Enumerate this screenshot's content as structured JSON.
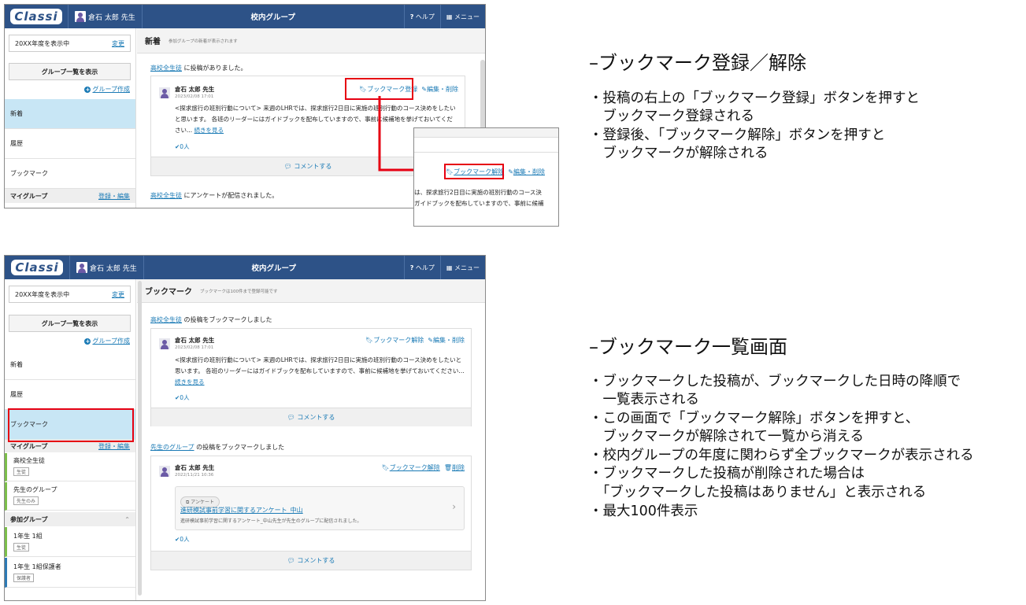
{
  "app": {
    "logo": "Classi",
    "user_name": "倉石 太郎 先生",
    "window_title": "校内グループ",
    "help_label": "ヘルプ",
    "menu_label": "メニュー"
  },
  "sidebar": {
    "year_text": "20XX年度を表示中",
    "year_change": "変更",
    "group_list_button": "グループ一覧を表示",
    "create_group": "グループ作成",
    "nav_new": "新着",
    "nav_history": "履歴",
    "nav_bookmark": "ブックマーク",
    "my_group_label": "マイグループ",
    "register_edit": "登録・編集",
    "my_groups": [
      {
        "name": "高校全生徒",
        "tag": "生徒"
      },
      {
        "name": "先生のグループ",
        "tag": "先生のみ"
      }
    ],
    "joined_label": "参加グループ",
    "joined_groups": [
      {
        "name": "1年生 1組",
        "tag": "生徒"
      },
      {
        "name": "1年生 1組保護者",
        "tag": "保護者"
      }
    ]
  },
  "shot1": {
    "header_title": "新着",
    "header_sub": "参加グループの新着が表示されます",
    "note1_link": "高校全生徒",
    "note1_text": " に投稿がありました。",
    "post": {
      "author": "倉石 太郎 先生",
      "date": "2023/02/08 17:01",
      "bookmark_btn": "ブックマーク登録",
      "edit_btn": "編集・削除",
      "body": "<探求旅行の班別行動について> 来週のLHRでは、探求旅行2日目に実施の班別行動のコース決めをしたいと思います。 各班のリーダーにはガイドブックを配布していますので、事前に候補地を挙げておいてください... ",
      "read_more": "続きを見る",
      "likes": "0人",
      "comment": "コメントする"
    },
    "note2_link": "高校全生徒",
    "note2_text": " にアンケートが配信されました。",
    "zoom": {
      "unbookmark_btn": "ブックマーク解除",
      "edit_btn": "編集・削除",
      "line1": "は、探求旅行2日目に実施の班別行動のコース決",
      "line2": "ガイドブックを配布していますので、事前に候補"
    }
  },
  "shot2": {
    "header_title": "ブックマーク",
    "header_sub": "ブックマークは100件まで登録可能です",
    "note1_link": "高校全生徒",
    "note1_text": " の投稿をブックマークしました",
    "post1": {
      "author": "倉石 太郎 先生",
      "date": "2023/02/08 17:01",
      "unbookmark_btn": "ブックマーク解除",
      "edit_btn": "編集・削除",
      "body": "<探求旅行の班別行動について> 来週のLHRでは、探求旅行2日目に実施の班別行動のコース決めをしたいと思います。 各班のリーダーにはガイドブックを配布していますので、事前に候補地を挙げておいてください... ",
      "read_more": "続きを見る",
      "likes": "0人",
      "comment": "コメントする"
    },
    "note2_link": "先生のグループ",
    "note2_text": " の投稿をブックマークしました",
    "post2": {
      "author": "倉石 太郎 先生",
      "date": "2022/11/21 10:36",
      "unbookmark_btn": "ブックマーク解除",
      "delete_btn": "削除",
      "attach_pill": "アンケート",
      "attach_title": "進研模試事前学習に関するアンケート_中山",
      "attach_desc": "進研模試事前学習に関するアンケート_中山先生が先生のグループに配信されました。",
      "likes": "0人",
      "comment": "コメントする"
    }
  },
  "panel1": {
    "heading": "–ブックマーク登録／解除",
    "bullets": [
      "・投稿の右上の「ブックマーク登録」ボタンを押すと",
      "　ブックマーク登録される",
      "・登録後、「ブックマーク解除」ボタンを押すと",
      "　ブックマークが解除される"
    ]
  },
  "panel2": {
    "heading": "–ブックマーク一覧画面",
    "bullets": [
      "・ブックマークした投稿が、ブックマークした日時の降順で",
      "　一覧表示される",
      "・この画面で「ブックマーク解除」ボタンを押すと、",
      "　ブックマークが解除されて一覧から消える",
      "・校内グループの年度に関わらず全ブックマークが表示される",
      "・ブックマークした投稿が削除された場合は",
      "　「ブックマークした投稿はありません」と表示される",
      "・最大100件表示"
    ]
  },
  "colors": {
    "brand": "#2d5287",
    "link": "#1a7ab5",
    "highlight": "#e60012",
    "active_nav": "#c8e6f5"
  }
}
